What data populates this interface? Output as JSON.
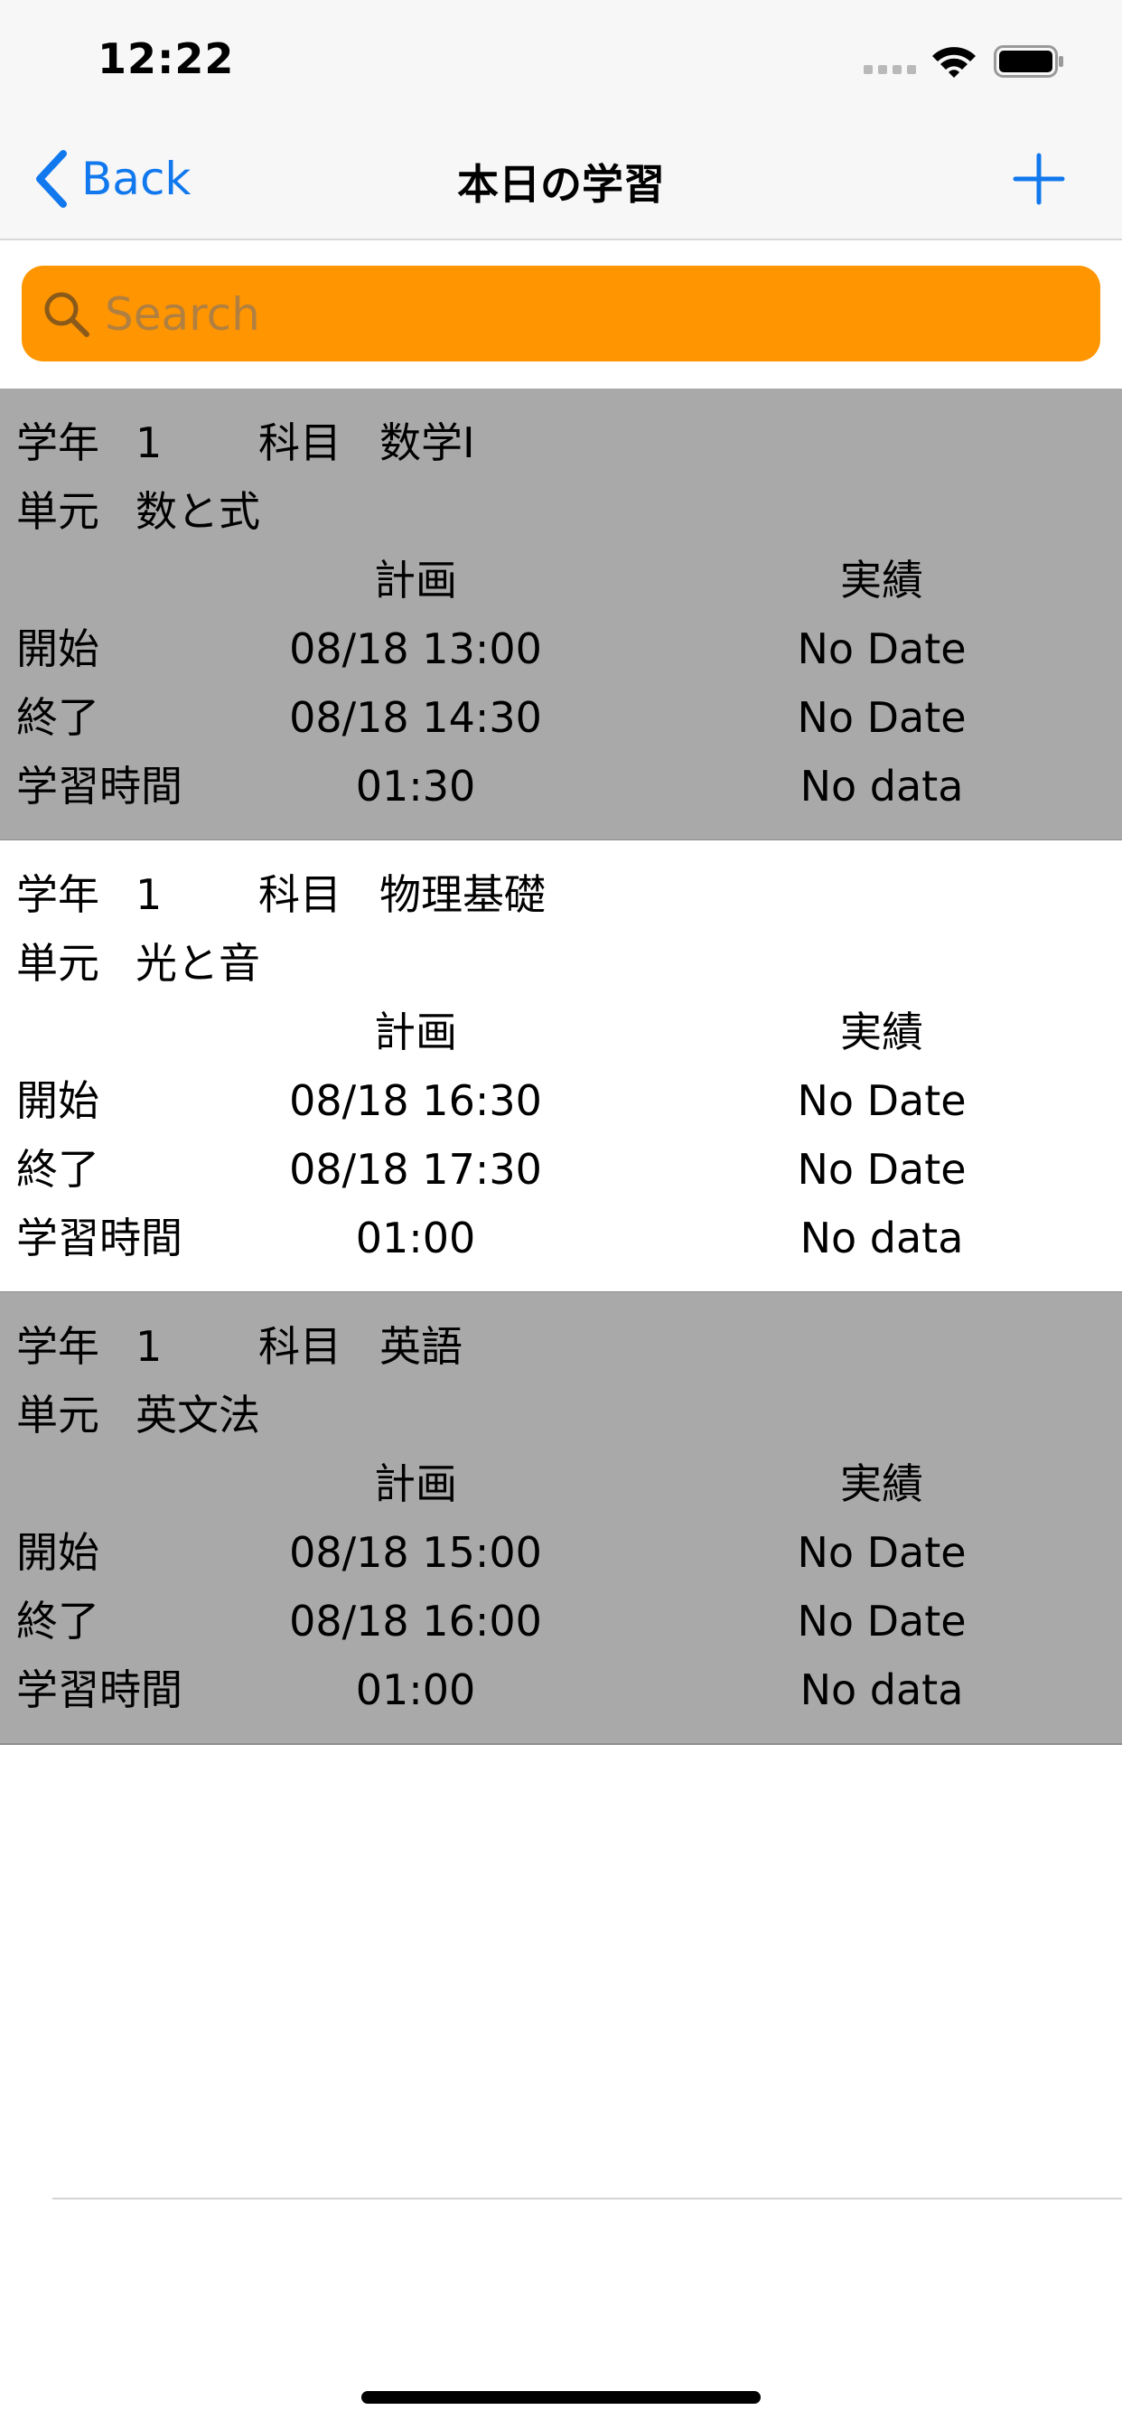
{
  "status_bar": {
    "time": "12:22"
  },
  "nav": {
    "back_label": "Back",
    "title": "本日の学習"
  },
  "search": {
    "placeholder": "Search",
    "value": ""
  },
  "colors": {
    "accent": "#1178ee",
    "search_bg": "#ff9500",
    "row_gray": "#a9a9a9"
  },
  "rows": [
    {
      "grade_label": "学年",
      "grade": "1",
      "subject_label": "科目",
      "subject": "数学I",
      "unit_label": "単元",
      "unit": "数と式",
      "plan_header": "計画",
      "actual_header": "実績",
      "start_label": "開始",
      "plan_start": "08/18 13:00",
      "actual_start": "No Date",
      "end_label": "終了",
      "plan_end": "08/18 14:30",
      "actual_end": "No Date",
      "duration_label": "学習時間",
      "plan_duration": "01:30",
      "actual_duration": "No data"
    },
    {
      "grade_label": "学年",
      "grade": "1",
      "subject_label": "科目",
      "subject": "物理基礎",
      "unit_label": "単元",
      "unit": "光と音",
      "plan_header": "計画",
      "actual_header": "実績",
      "start_label": "開始",
      "plan_start": "08/18 16:30",
      "actual_start": "No Date",
      "end_label": "終了",
      "plan_end": "08/18 17:30",
      "actual_end": "No Date",
      "duration_label": "学習時間",
      "plan_duration": "01:00",
      "actual_duration": "No data"
    },
    {
      "grade_label": "学年",
      "grade": "1",
      "subject_label": "科目",
      "subject": "英語",
      "unit_label": "単元",
      "unit": "英文法",
      "plan_header": "計画",
      "actual_header": "実績",
      "start_label": "開始",
      "plan_start": "08/18 15:00",
      "actual_start": "No Date",
      "end_label": "終了",
      "plan_end": "08/18 16:00",
      "actual_end": "No Date",
      "duration_label": "学習時間",
      "plan_duration": "01:00",
      "actual_duration": "No data"
    }
  ]
}
